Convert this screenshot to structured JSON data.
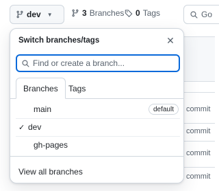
{
  "topbar": {
    "branch_button_label": "dev",
    "branches_count": "3",
    "branches_label": "Branches",
    "tags_count": "0",
    "tags_label": "Tags",
    "goto_placeholder": "Go"
  },
  "background": {
    "commit_labels": [
      "commit",
      "commit",
      "commit",
      "commit"
    ]
  },
  "dropdown": {
    "title": "Switch branches/tags",
    "search_placeholder": "Find or create a branch...",
    "tabs": [
      {
        "label": "Branches",
        "selected": true
      },
      {
        "label": "Tags",
        "selected": false
      }
    ],
    "branches": [
      {
        "name": "main",
        "badge": "default",
        "checked": false
      },
      {
        "name": "dev",
        "badge": "",
        "checked": true
      },
      {
        "name": "gh-pages",
        "badge": "",
        "checked": false
      }
    ],
    "check_glyph": "✓",
    "footer_link": "View all branches"
  },
  "colors": {
    "accent": "#0969da",
    "border": "#d0d7de",
    "muted_text": "#59636e"
  }
}
